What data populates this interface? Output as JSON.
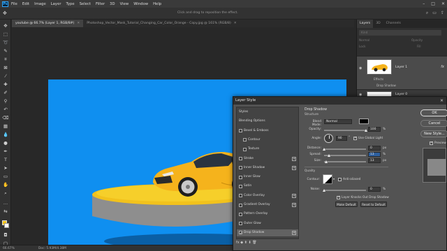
{
  "menubar": {
    "logo": "Ps",
    "items": [
      "File",
      "Edit",
      "Image",
      "Layer",
      "Type",
      "Select",
      "Filter",
      "3D",
      "View",
      "Window",
      "Help"
    ]
  },
  "optionsbar": {
    "hint": "Click and drag to reposition the effect."
  },
  "document_tabs": [
    {
      "label": "youtube @ 66.7% (Layer 1, RGB/8#)",
      "active": true
    },
    {
      "label": "Photoshop_Vector_Mask_Tutorial_Changing_Car_Color_Orange - Copy.jpg @ 161% (RGB/8)",
      "active": false
    }
  ],
  "statusbar": {
    "zoom": "66.67%",
    "doc_info": "Doc: 5.93M/4.38M"
  },
  "colors": {
    "document_bg": "#0f8ff0",
    "car_body": "#f5b31c",
    "foreground": "#f5c518",
    "background": "#ffffff"
  },
  "layers_panel": {
    "tabs": [
      "Layers",
      "3D",
      "Channels"
    ],
    "filter_placeholder": "Kind",
    "blend_mode": "Normal",
    "opacity_label": "Opacity",
    "lock_label": "Lock",
    "fill_label": "Fill",
    "layer_name": "Layer 1",
    "fx_mark": "fx",
    "effects_label": "Effects",
    "effect_items": [
      "Drop Shadow"
    ],
    "second_layer": "Layer 0"
  },
  "dialog": {
    "title": "Layer Style",
    "styles": [
      {
        "label": "Styles",
        "type": "head"
      },
      {
        "label": "Blending Options",
        "type": "head"
      },
      {
        "label": "Bevel & Emboss",
        "type": "check",
        "checked": false
      },
      {
        "label": "Contour",
        "type": "subcheck",
        "checked": false
      },
      {
        "label": "Texture",
        "type": "subcheck",
        "checked": false
      },
      {
        "label": "Stroke",
        "type": "check",
        "checked": false,
        "plus": true
      },
      {
        "label": "Inner Shadow",
        "type": "check",
        "checked": false,
        "plus": true
      },
      {
        "label": "Inner Glow",
        "type": "check",
        "checked": false
      },
      {
        "label": "Satin",
        "type": "check",
        "checked": false
      },
      {
        "label": "Color Overlay",
        "type": "check",
        "checked": false,
        "plus": true
      },
      {
        "label": "Gradient Overlay",
        "type": "check",
        "checked": false,
        "plus": true
      },
      {
        "label": "Pattern Overlay",
        "type": "check",
        "checked": false
      },
      {
        "label": "Outer Glow",
        "type": "check",
        "checked": false
      },
      {
        "label": "Drop Shadow",
        "type": "check",
        "checked": true,
        "plus": true,
        "active": true
      }
    ],
    "fx_bar": "fx  ◆  ⬆  ⬇                    🗑",
    "settings": {
      "section_title": "Drop Shadow",
      "structure": "Structure",
      "blend_mode_label": "Blend Mode:",
      "blend_mode_value": "Normal",
      "opacity_label": "Opacity:",
      "opacity_value": "100",
      "angle_label": "Angle:",
      "angle_value": "90",
      "global_light_label": "Use Global Light",
      "global_light_checked": true,
      "distance_label": "Distance:",
      "distance_value": "0",
      "spread_label": "Spread:",
      "spread_value": "13",
      "size_label": "Size:",
      "size_value": "13",
      "unit_px": "px",
      "unit_pct": "%",
      "degree": "°",
      "quality": "Quality",
      "contour_label": "Contour:",
      "anti_aliased_label": "Anti-aliased",
      "noise_label": "Noise:",
      "noise_value": "0",
      "knockout_label": "Layer Knocks Out Drop Shadow",
      "knockout_checked": true,
      "make_default": "Make Default",
      "reset_default": "Reset to Default",
      "opacity_level": 1.0,
      "distance_level": 0.0,
      "spread_level": 0.13,
      "size_level": 0.05,
      "noise_level": 0.0
    },
    "buttons": {
      "ok": "OK",
      "cancel": "Cancel",
      "new_style": "New Style...",
      "preview": "Preview"
    },
    "preview_checked": true
  }
}
